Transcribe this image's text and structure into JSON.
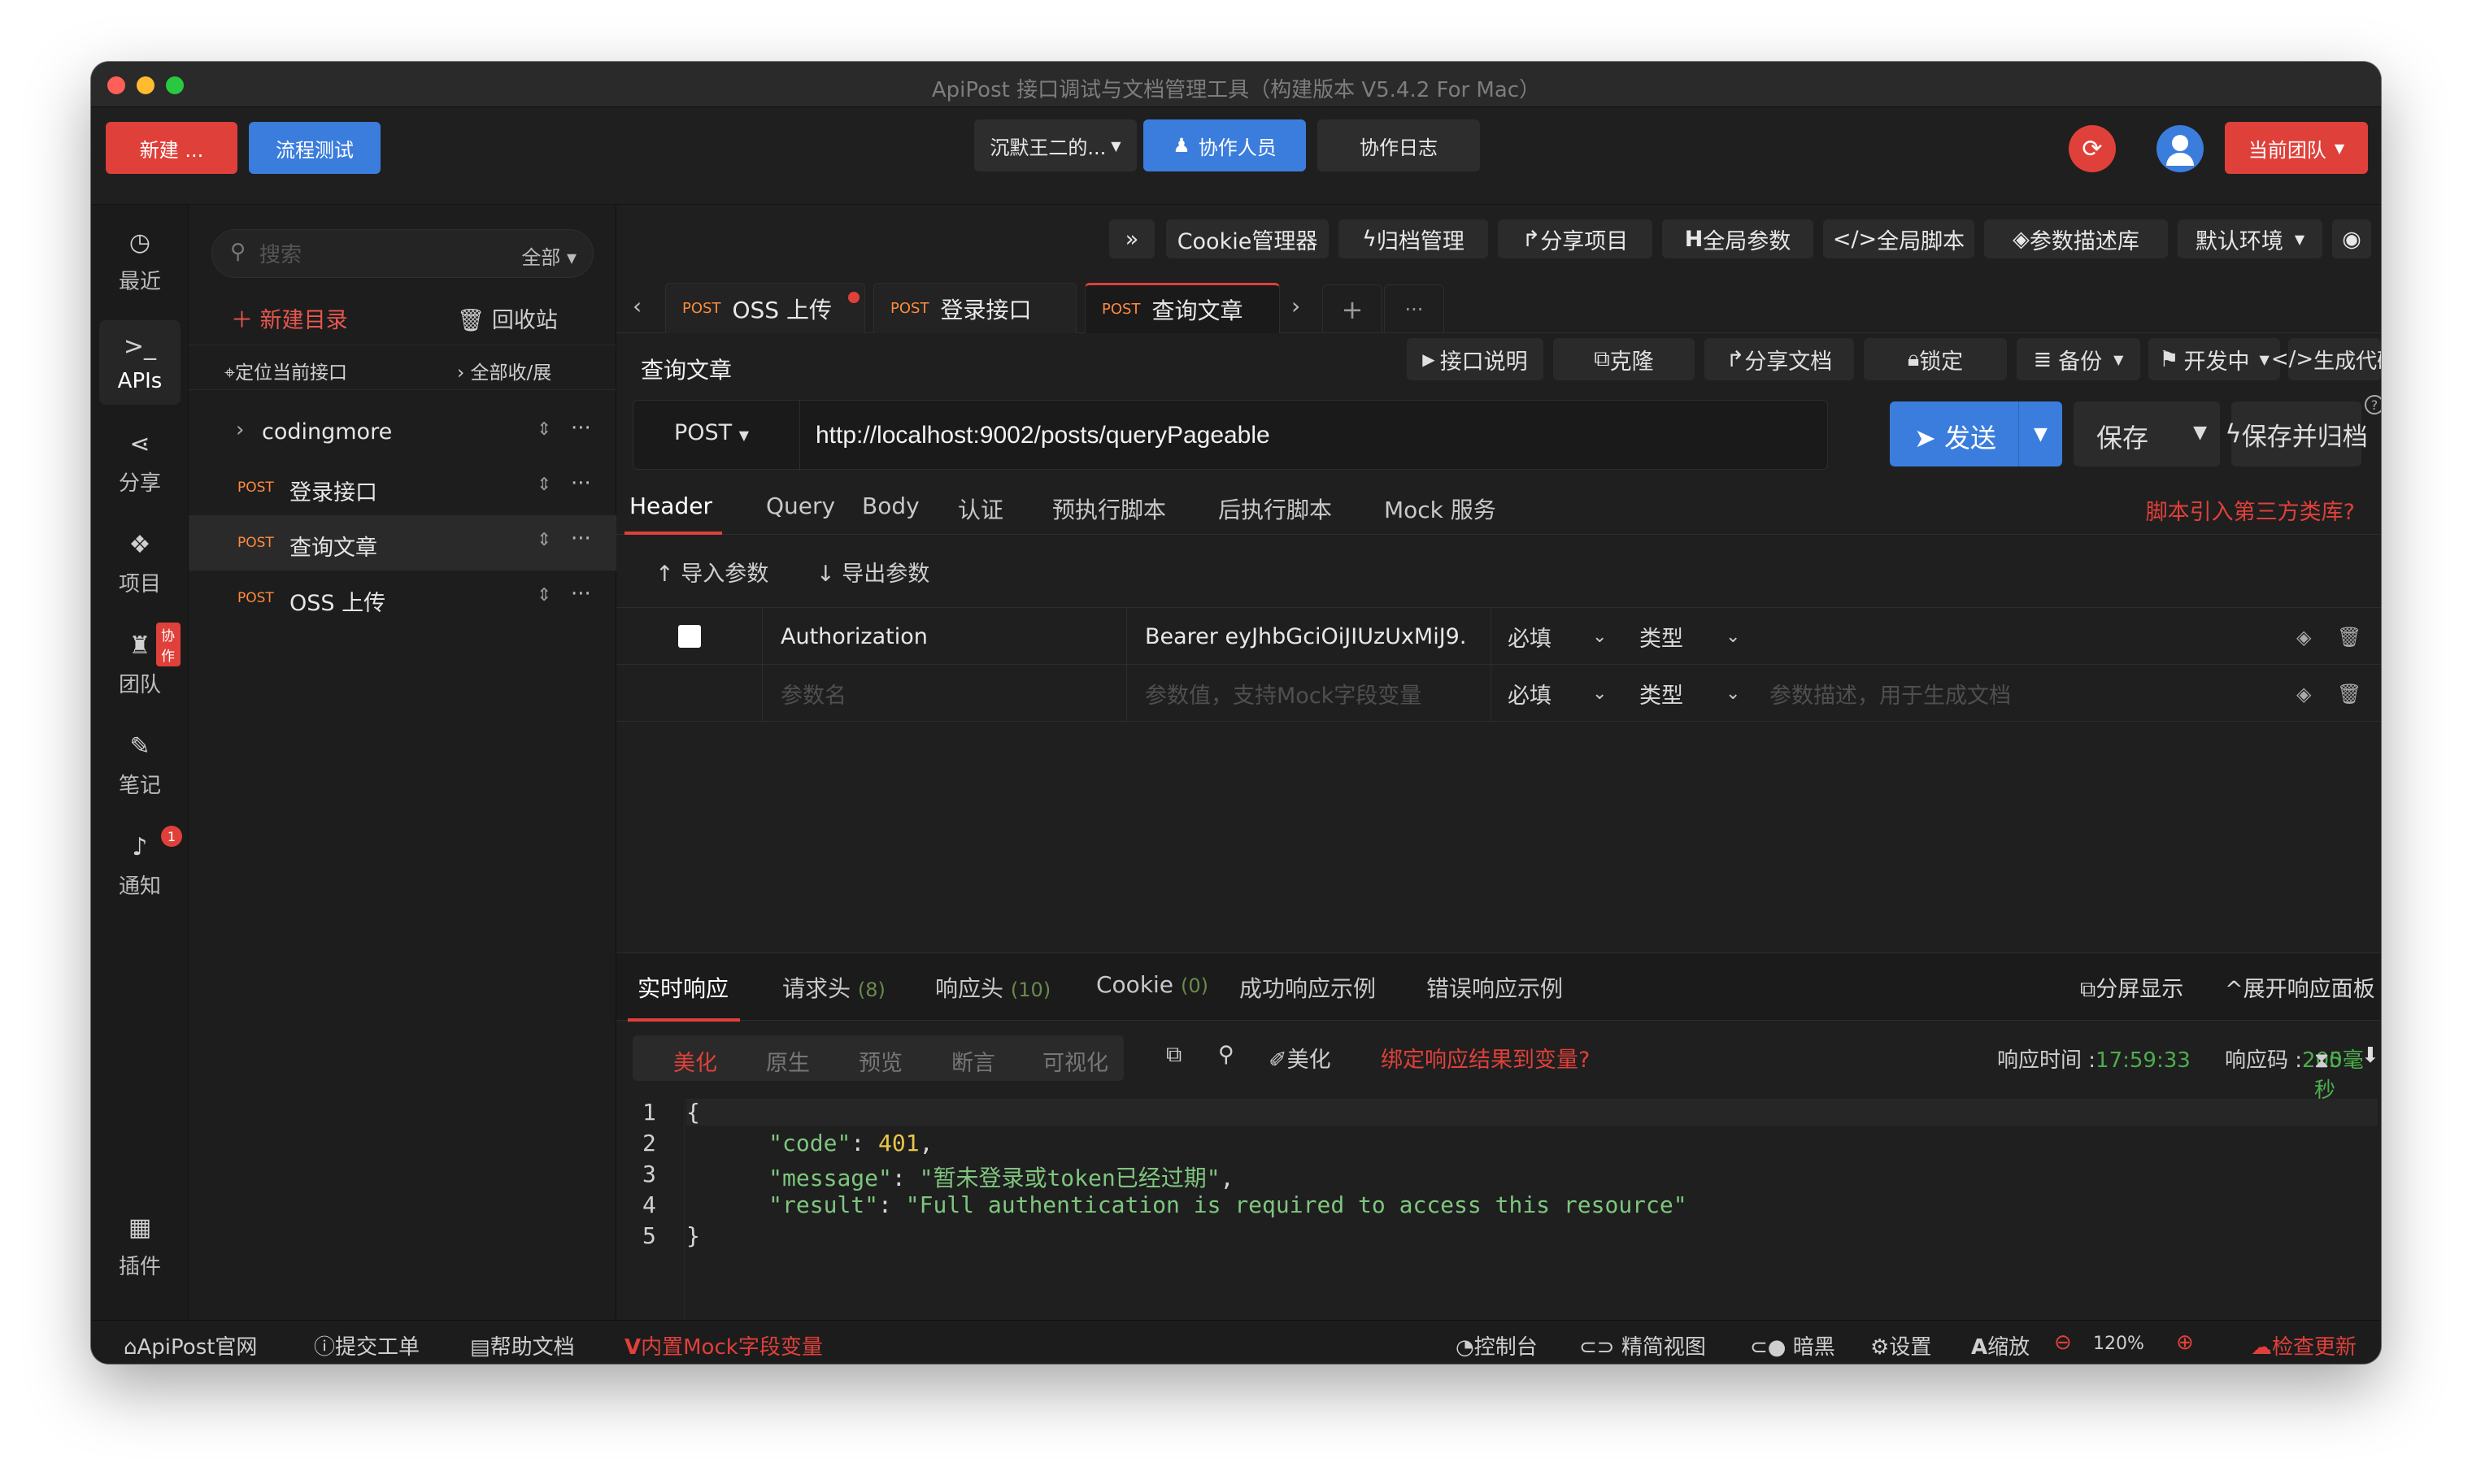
{
  "window": {
    "title": "ApiPost 接口调试与文档管理工具（构建版本 V5.4.2 For Mac）"
  },
  "toolbar": {
    "new_label": "新建 ...",
    "flow_label": "流程测试",
    "workspace_label": "沉默王二的...",
    "collab_label": "协作人员",
    "log_label": "协作日志",
    "team_label": "当前团队"
  },
  "leftnav": [
    {
      "label": "最近",
      "icon": "clock-icon"
    },
    {
      "label": "APIs",
      "icon": "terminal-icon"
    },
    {
      "label": "分享",
      "icon": "share-icon"
    },
    {
      "label": "项目",
      "icon": "project-icon"
    },
    {
      "label": "团队",
      "icon": "team-icon",
      "badge": "协作"
    },
    {
      "label": "笔记",
      "icon": "edit-icon"
    },
    {
      "label": "通知",
      "icon": "bell-icon",
      "badge": "1"
    },
    {
      "label": "插件",
      "icon": "grid-icon"
    }
  ],
  "tree": {
    "search_placeholder": "搜索",
    "filter": "全部",
    "new_dir": "新建目录",
    "recycle": "回收站",
    "locate": "定位当前接口",
    "expand": "全部收/展",
    "folder": "codingmore",
    "items": [
      {
        "method": "POST",
        "label": "登录接口"
      },
      {
        "method": "POST",
        "label": "查询文章"
      },
      {
        "method": "POST",
        "label": "OSS 上传"
      }
    ]
  },
  "main": {
    "top_buttons": [
      "»",
      "Cookie管理器",
      "归档管理",
      "分享项目",
      "全局参数",
      "全局脚本",
      "参数描述库",
      "默认环境"
    ],
    "tabs": [
      {
        "method": "POST",
        "label": "OSS 上传"
      },
      {
        "method": "POST",
        "label": "登录接口"
      },
      {
        "method": "POST",
        "label": "查询文章"
      }
    ],
    "tab_more": "···",
    "request_name": "查询文章",
    "req_buttons": [
      "接口说明",
      "克隆",
      "分享文档",
      "锁定",
      "备份",
      "开发中",
      "生成代码"
    ],
    "method": "POST",
    "url": "http://localhost:9002/posts/queryPageable",
    "send": "发送",
    "save": "保存",
    "save_archive": "保存并归档",
    "req_tabs": [
      "Header",
      "Query",
      "Body",
      "认证",
      "预执行脚本",
      "后执行脚本",
      "Mock 服务"
    ],
    "script_link": "脚本引入第三方类库?",
    "import_params": "导入参数",
    "export_params": "导出参数",
    "params": [
      {
        "key": "Authorization",
        "value": "Bearer eyJhbGciOiJIUzUxMiJ9.",
        "required": "必填",
        "type": "类型"
      }
    ],
    "new_param": {
      "key_placeholder": "参数名",
      "value_placeholder": "参数值，支持Mock字段变量",
      "required": "必填",
      "type": "类型",
      "desc_placeholder": "参数描述，用于生成文档"
    }
  },
  "response": {
    "tabs": [
      {
        "label": "实时响应",
        "count": ""
      },
      {
        "label": "请求头",
        "count": "(8)"
      },
      {
        "label": "响应头",
        "count": "(10)"
      },
      {
        "label": "Cookie",
        "count": "(0)"
      },
      {
        "label": "成功响应示例",
        "count": ""
      },
      {
        "label": "错误响应示例",
        "count": ""
      }
    ],
    "split": "分屏显示",
    "expand": "展开响应面板",
    "views": [
      "美化",
      "原生",
      "预览",
      "断言",
      "可视化"
    ],
    "beautify": "美化",
    "bind_link": "绑定响应结果到变量?",
    "time_label": "响应时间 :",
    "time": "17:59:33",
    "code_label": "响应码 :",
    "code": "200",
    "duration": "5毫秒",
    "body_lines": [
      {
        "no": "1",
        "text": "{"
      },
      {
        "no": "2",
        "key": "\"code\"",
        "val": "401",
        "type": "num",
        "comma": ","
      },
      {
        "no": "3",
        "key": "\"message\"",
        "val": "\"暂未登录或token已经过期\"",
        "type": "str",
        "comma": ","
      },
      {
        "no": "4",
        "key": "\"result\"",
        "val": "\"Full authentication is required to access this resource\"",
        "type": "str",
        "comma": ""
      },
      {
        "no": "5",
        "text": "}"
      }
    ]
  },
  "status": {
    "site": "ApiPost官网",
    "ticket": "提交工单",
    "docs": "帮助文档",
    "mock": "内置Mock字段变量",
    "console": "控制台",
    "simple": "精简视图",
    "dark": "暗黑",
    "settings": "设置",
    "zoom_label": "缩放",
    "zoom": "120%",
    "update": "检查更新"
  },
  "colors": {
    "accent_red": "#e0403a",
    "accent_blue": "#3b7ddd",
    "method_orange": "#ff8a3d"
  }
}
